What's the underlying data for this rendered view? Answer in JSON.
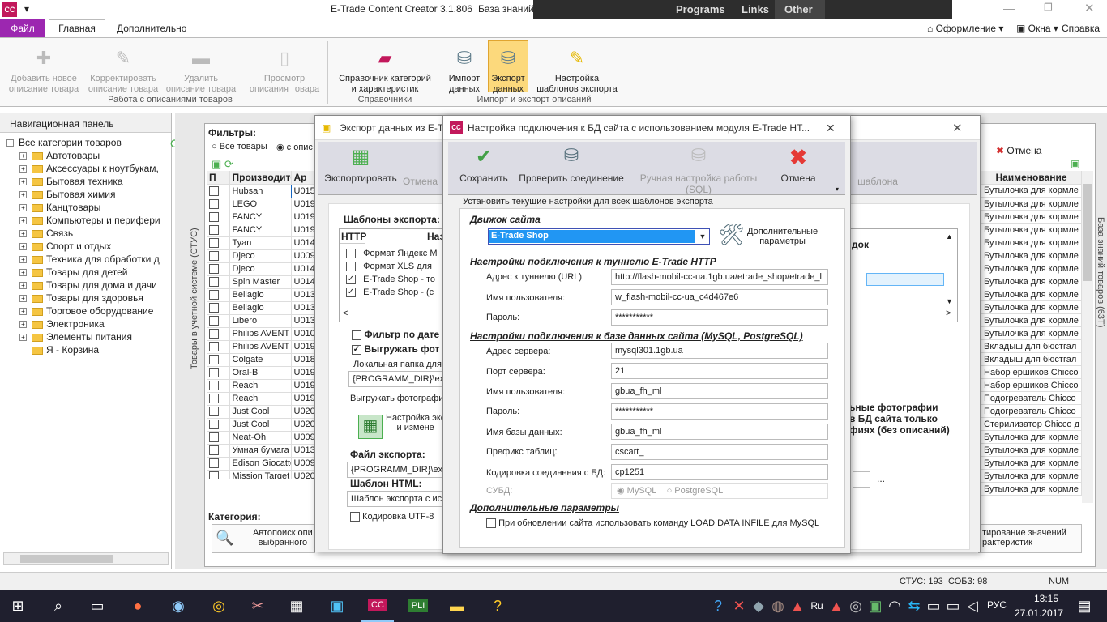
{
  "app": {
    "title": "E-Trade Content Creator 3.1.806",
    "subtitle": "База знаний"
  },
  "overlay": {
    "items": [
      "Programs",
      "Links",
      "Other"
    ]
  },
  "tabs": {
    "file": "Файл",
    "main": "Главная",
    "extra": "Дополнительно"
  },
  "rightmenu": {
    "design": "Оформление",
    "windows": "Окна",
    "help": "Справка"
  },
  "ribbon": {
    "g1": {
      "label": "Работа с описаниями товаров",
      "b1": "Добавить новое\nописание товара",
      "b2": "Корректировать\nописание товара",
      "b3": "Удалить\nописание товара",
      "b4": "Просмотр\nописания товара"
    },
    "g2": {
      "label": "Справочники",
      "b1": "Справочник категорий\nи характеристик"
    },
    "g3": {
      "label": "Импорт и экспорт описаний",
      "b1": "Импорт\nданных",
      "b2": "Экспорт\nданных",
      "b3": "Настройка\nшаблонов экспорта"
    }
  },
  "nav": {
    "title": "Навигационная панель",
    "root": "Все категории товаров",
    "items": [
      "Автотовары",
      "Аксессуары к ноутбукам,",
      "Бытовая техника",
      "Бытовая химия",
      "Канцтовары",
      "Компьютеры и перифери",
      "Связь",
      "Спорт и отдых",
      "Техника для обработки д",
      "Товары для детей",
      "Товары для дома и дачи",
      "Товары для здоровья",
      "Торговое оборудование",
      "Электроника",
      "Элементы питания",
      "Я - Корзина"
    ]
  },
  "main": {
    "sidetext": "Товары в учетной системе (СТУС)",
    "righttext": "База знаний товаров (63Т)",
    "filters": "Фильтры:",
    "allgoods": "Все товары",
    "withdesc": "с опис",
    "col_p": "П",
    "col_maker": "Производите",
    "col_art": "Ар",
    "col_name": "Наименование",
    "cancel": "Отмена",
    "category": "Категория:",
    "autosearch": "Автопоиск опи\nвыбранного",
    "correct": "тирование значений\nрактеристик",
    "makers": [
      "Hubsan",
      "LEGO",
      "FANCY",
      "FANCY",
      "Tyan",
      "Djeco",
      "Djeco",
      "Spin Master",
      "Bellagio",
      "Bellagio",
      "Libero",
      "Philips AVENT",
      "Philips AVENT",
      "Colgate",
      "Oral-B",
      "Reach",
      "Reach",
      "Just Cool",
      "Just Cool",
      "Neat-Oh",
      "Умная бумага",
      "Edison Giocattoli",
      "Mission Target"
    ],
    "arts": [
      "U015",
      "U019",
      "U019",
      "U019",
      "U014",
      "U009",
      "U014",
      "U014",
      "U013",
      "U013",
      "U013",
      "U010",
      "U019",
      "U018",
      "U019",
      "U019",
      "U019",
      "U020",
      "U020",
      "U009",
      "U013",
      "U009",
      "U020"
    ],
    "names": [
      "Бутылочка для кормле",
      "Бутылочка для кормле",
      "Бутылочка для кормле",
      "Бутылочка для кормле",
      "Бутылочка для кормле",
      "Бутылочка для кормле",
      "Бутылочка для кормле",
      "Бутылочка для кормле",
      "Бутылочка для кормле",
      "Бутылочка для кормле",
      "Бутылочка для кормле",
      "Бутылочка для кормле",
      "Вкладыш для бюстгал",
      "Вкладыш для бюстгал",
      "Набор ершиков Chicco",
      "Набор ершиков Chicco",
      "Подогреватель Chicco",
      "Подогреватель Chicco",
      "Стерилизатор Chicco д",
      "Бутылочка для кормле",
      "Бутылочка для кормле",
      "Бутылочка для кормле",
      "Бутылочка для кормле",
      "Бутылочка для кормле"
    ]
  },
  "exportwin": {
    "title": "Экспорт данных из E-Tra",
    "export": "Экспортировать",
    "cancel": "Отмена",
    "templates": "Шаблоны экспорта:",
    "http": "HTTP",
    "col_name": "Наз",
    "col_order": "док",
    "tpl": [
      "Формат Яндекс М",
      "Формат XLS для",
      "E-Trade Shop - то",
      "E-Trade Shop - (с"
    ],
    "filterdate": "Фильтр по дате",
    "uploadphotos": "Выгружать фот",
    "localfolder": "Локальная папка для",
    "folderval": "{PROGRAMM_DIR}\\exp",
    "uploadphotos2": "Выгружать фотографи",
    "setup": "Настройка экс\nи измене",
    "exportfile": "Файл экспорта:",
    "fileval": "{PROGRAMM_DIR}\\expo",
    "tplhtml": "Шаблон HTML:",
    "tplhtmlval": "Шаблон экспорта с исп",
    "utf8": "Кодировка UTF-8",
    "tplbtn": "шаблона",
    "photos": "ьные фотографии\nв БД сайта только\nфиях (без описаний)",
    "dots": "..."
  },
  "dialog": {
    "title": "Настройка подключения к БД сайта с использованием модуля E-Trade HT...",
    "save": "Сохранить",
    "check": "Проверить соединение",
    "manual": "Ручная настройка работы (SQL)",
    "cancel": "Отмена",
    "note": "Установить текущие настройки для всех шаблонов экспорта",
    "engine": "Движок сайта",
    "engineval": "E-Trade Shop",
    "extra": "Дополнительные\nпараметры",
    "tunnel": "Настройки подключения к туннелю E-Trade HTTP",
    "url_l": "Адрес к туннелю (URL):",
    "url_v": "http://flash-mobil-cc-ua.1gb.ua/etrade_shop/etrade_l",
    "user_l": "Имя пользователя:",
    "user_v": "w_flash-mobil-cc-ua_c4d467e6",
    "pass_l": "Пароль:",
    "pass_v": "***********",
    "db": "Настройки подключения к базе данных сайта (MySQL, PostgreSQL)",
    "srv_l": "Адрес сервера:",
    "srv_v": "mysql301.1gb.ua",
    "port_l": "Порт сервера:",
    "port_v": "21",
    "dbuser_l": "Имя пользователя:",
    "dbuser_v": "gbua_fh_ml",
    "dbpass_l": "Пароль:",
    "dbpass_v": "***********",
    "dbname_l": "Имя базы данных:",
    "dbname_v": "gbua_fh_ml",
    "prefix_l": "Префикс таблиц:",
    "prefix_v": "cscart_",
    "enc_l": "Кодировка соединения с БД:",
    "enc_v": "cp1251",
    "dbms_l": "СУБД:",
    "mysql": "MySQL",
    "pg": "PostgreSQL",
    "addparams": "Дополнительные параметры",
    "loaddata": "При обновлении сайта использовать команду LOAD DATA INFILE для MySQL"
  },
  "status": {
    "stus": "СТУС: 193",
    "sobz": "СОБЗ: 98",
    "num": "NUM"
  },
  "tray": {
    "lang": "РУС",
    "time": "13:15",
    "date": "27.01.2017"
  }
}
